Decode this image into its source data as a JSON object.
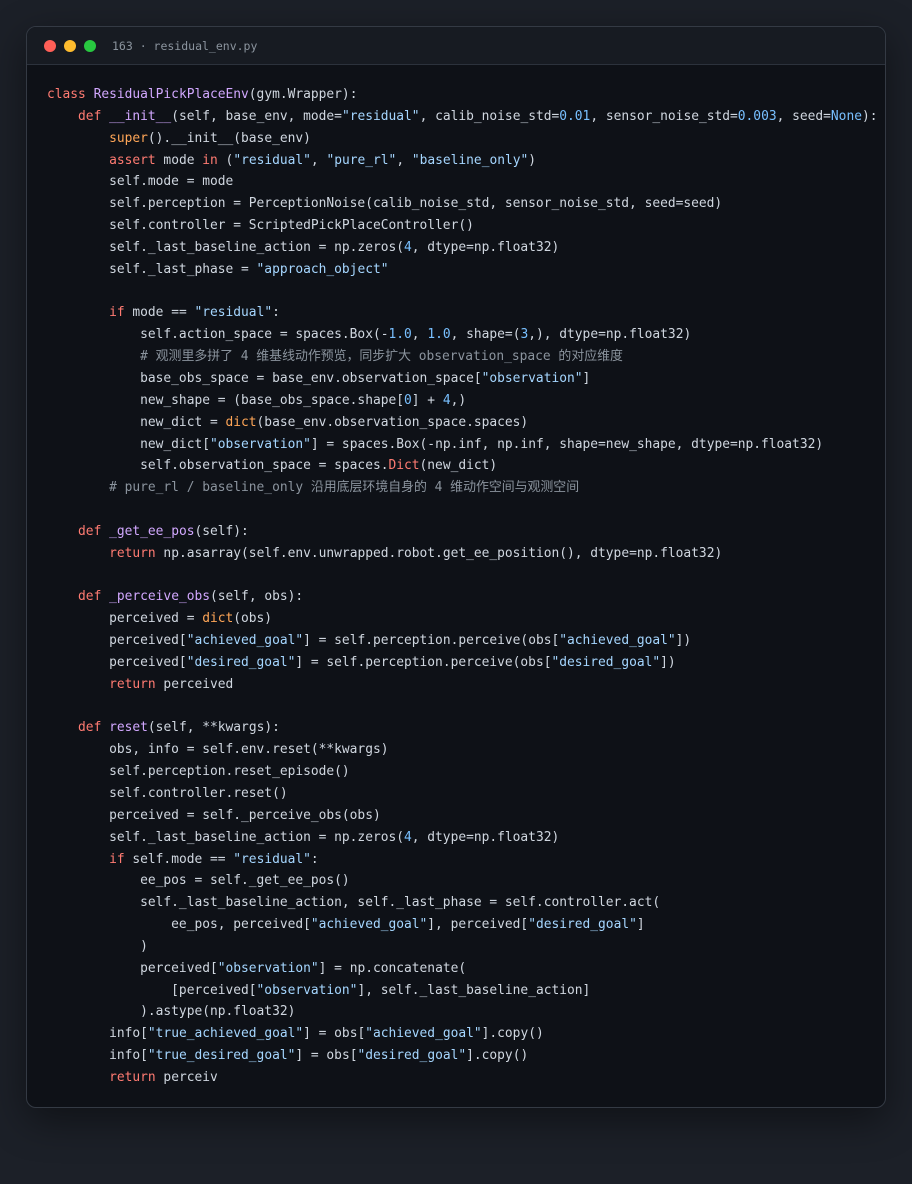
{
  "window": {
    "title": "163 · residual_env.py"
  },
  "colors": {
    "keyword": "#ff7b72",
    "builtin": "#ffa657",
    "function": "#d2a8ff",
    "string": "#a5d6ff",
    "number": "#79c0ff",
    "comment": "#8b949e",
    "text": "#d0d7e0",
    "background": "#0e1117"
  },
  "code": {
    "language": "python",
    "lines": [
      [
        [
          "kw",
          "class"
        ],
        [
          "t",
          " "
        ],
        [
          "fn",
          "ResidualPickPlaceEnv"
        ],
        [
          "t",
          "(gym.Wrapper):"
        ]
      ],
      [
        [
          "t",
          "    "
        ],
        [
          "kw",
          "def"
        ],
        [
          "t",
          " "
        ],
        [
          "fn",
          "__init__"
        ],
        [
          "t",
          "(self, base_env, mode="
        ],
        [
          "str",
          "\"residual\""
        ],
        [
          "t",
          ", calib_noise_std="
        ],
        [
          "num",
          "0.01"
        ],
        [
          "t",
          ", sensor_noise_std="
        ],
        [
          "num",
          "0.003"
        ],
        [
          "t",
          ", seed="
        ],
        [
          "num",
          "None"
        ],
        [
          "t",
          "):"
        ]
      ],
      [
        [
          "t",
          "        "
        ],
        [
          "bi",
          "super"
        ],
        [
          "t",
          "().__init__(base_env)"
        ]
      ],
      [
        [
          "t",
          "        "
        ],
        [
          "kw",
          "assert"
        ],
        [
          "t",
          " mode "
        ],
        [
          "kw",
          "in"
        ],
        [
          "t",
          " ("
        ],
        [
          "str",
          "\"residual\""
        ],
        [
          "t",
          ", "
        ],
        [
          "str",
          "\"pure_rl\""
        ],
        [
          "t",
          ", "
        ],
        [
          "str",
          "\"baseline_only\""
        ],
        [
          "t",
          ")"
        ]
      ],
      [
        [
          "t",
          "        self.mode = mode"
        ]
      ],
      [
        [
          "t",
          "        self.perception = PerceptionNoise(calib_noise_std, sensor_noise_std, seed=seed)"
        ]
      ],
      [
        [
          "t",
          "        self.controller = ScriptedPickPlaceController()"
        ]
      ],
      [
        [
          "t",
          "        self._last_baseline_action = np.zeros("
        ],
        [
          "num",
          "4"
        ],
        [
          "t",
          ", dtype=np.float32)"
        ]
      ],
      [
        [
          "t",
          "        self._last_phase = "
        ],
        [
          "str",
          "\"approach_object\""
        ]
      ],
      [],
      [
        [
          "t",
          "        "
        ],
        [
          "kw",
          "if"
        ],
        [
          "t",
          " mode == "
        ],
        [
          "str",
          "\"residual\""
        ],
        [
          "t",
          ":"
        ]
      ],
      [
        [
          "t",
          "            self.action_space = spaces.Box(-"
        ],
        [
          "num",
          "1.0"
        ],
        [
          "t",
          ", "
        ],
        [
          "num",
          "1.0"
        ],
        [
          "t",
          ", shape=("
        ],
        [
          "num",
          "3"
        ],
        [
          "t",
          ",), dtype=np.float32)"
        ]
      ],
      [
        [
          "t",
          "            "
        ],
        [
          "cm",
          "# 观测里多拼了 4 维基线动作预览，同步扩大 observation_space 的对应维度"
        ]
      ],
      [
        [
          "t",
          "            base_obs_space = base_env.observation_space["
        ],
        [
          "str",
          "\"observation\""
        ],
        [
          "t",
          "]"
        ]
      ],
      [
        [
          "t",
          "            new_shape = (base_obs_space.shape["
        ],
        [
          "num",
          "0"
        ],
        [
          "t",
          "] + "
        ],
        [
          "num",
          "4"
        ],
        [
          "t",
          ",)"
        ]
      ],
      [
        [
          "t",
          "            new_dict = "
        ],
        [
          "bi",
          "dict"
        ],
        [
          "t",
          "(base_env.observation_space.spaces)"
        ]
      ],
      [
        [
          "t",
          "            new_dict["
        ],
        [
          "str",
          "\"observation\""
        ],
        [
          "t",
          "] = spaces.Box(-np.inf, np.inf, shape=new_shape, dtype=np.float32)"
        ]
      ],
      [
        [
          "t",
          "            self.observation_space = spaces."
        ],
        [
          "kw",
          "Dict"
        ],
        [
          "t",
          "(new_dict)"
        ]
      ],
      [
        [
          "t",
          "        "
        ],
        [
          "cm",
          "# pure_rl / baseline_only 沿用底层环境自身的 4 维动作空间与观测空间"
        ]
      ],
      [],
      [
        [
          "t",
          "    "
        ],
        [
          "kw",
          "def"
        ],
        [
          "t",
          " "
        ],
        [
          "fn",
          "_get_ee_pos"
        ],
        [
          "t",
          "(self):"
        ]
      ],
      [
        [
          "t",
          "        "
        ],
        [
          "kw",
          "return"
        ],
        [
          "t",
          " np.asarray(self.env.unwrapped.robot.get_ee_position(), dtype=np.float32)"
        ]
      ],
      [],
      [
        [
          "t",
          "    "
        ],
        [
          "kw",
          "def"
        ],
        [
          "t",
          " "
        ],
        [
          "fn",
          "_perceive_obs"
        ],
        [
          "t",
          "(self, obs):"
        ]
      ],
      [
        [
          "t",
          "        perceived = "
        ],
        [
          "bi",
          "dict"
        ],
        [
          "t",
          "(obs)"
        ]
      ],
      [
        [
          "t",
          "        perceived["
        ],
        [
          "str",
          "\"achieved_goal\""
        ],
        [
          "t",
          "] = self.perception.perceive(obs["
        ],
        [
          "str",
          "\"achieved_goal\""
        ],
        [
          "t",
          "])"
        ]
      ],
      [
        [
          "t",
          "        perceived["
        ],
        [
          "str",
          "\"desired_goal\""
        ],
        [
          "t",
          "] = self.perception.perceive(obs["
        ],
        [
          "str",
          "\"desired_goal\""
        ],
        [
          "t",
          "])"
        ]
      ],
      [
        [
          "t",
          "        "
        ],
        [
          "kw",
          "return"
        ],
        [
          "t",
          " perceived"
        ]
      ],
      [],
      [
        [
          "t",
          "    "
        ],
        [
          "kw",
          "def"
        ],
        [
          "t",
          " "
        ],
        [
          "fn",
          "reset"
        ],
        [
          "t",
          "(self, **kwargs):"
        ]
      ],
      [
        [
          "t",
          "        obs, info = self.env.reset(**kwargs)"
        ]
      ],
      [
        [
          "t",
          "        self.perception.reset_episode()"
        ]
      ],
      [
        [
          "t",
          "        self.controller.reset()"
        ]
      ],
      [
        [
          "t",
          "        perceived = self._perceive_obs(obs)"
        ]
      ],
      [
        [
          "t",
          "        self._last_baseline_action = np.zeros("
        ],
        [
          "num",
          "4"
        ],
        [
          "t",
          ", dtype=np.float32)"
        ]
      ],
      [
        [
          "t",
          "        "
        ],
        [
          "kw",
          "if"
        ],
        [
          "t",
          " self.mode == "
        ],
        [
          "str",
          "\"residual\""
        ],
        [
          "t",
          ":"
        ]
      ],
      [
        [
          "t",
          "            ee_pos = self._get_ee_pos()"
        ]
      ],
      [
        [
          "t",
          "            self._last_baseline_action, self._last_phase = self.controller.act("
        ]
      ],
      [
        [
          "t",
          "                ee_pos, perceived["
        ],
        [
          "str",
          "\"achieved_goal\""
        ],
        [
          "t",
          "], perceived["
        ],
        [
          "str",
          "\"desired_goal\""
        ],
        [
          "t",
          "]"
        ]
      ],
      [
        [
          "t",
          "            )"
        ]
      ],
      [
        [
          "t",
          "            perceived["
        ],
        [
          "str",
          "\"observation\""
        ],
        [
          "t",
          "] = np.concatenate("
        ]
      ],
      [
        [
          "t",
          "                [perceived["
        ],
        [
          "str",
          "\"observation\""
        ],
        [
          "t",
          "], self._last_baseline_action]"
        ]
      ],
      [
        [
          "t",
          "            ).astype(np.float32)"
        ]
      ],
      [
        [
          "t",
          "        info["
        ],
        [
          "str",
          "\"true_achieved_goal\""
        ],
        [
          "t",
          "] = obs["
        ],
        [
          "str",
          "\"achieved_goal\""
        ],
        [
          "t",
          "].copy()"
        ]
      ],
      [
        [
          "t",
          "        info["
        ],
        [
          "str",
          "\"true_desired_goal\""
        ],
        [
          "t",
          "] = obs["
        ],
        [
          "str",
          "\"desired_goal\""
        ],
        [
          "t",
          "].copy()"
        ]
      ],
      [
        [
          "t",
          "        "
        ],
        [
          "kw",
          "return"
        ],
        [
          "t",
          " perceiv"
        ]
      ]
    ]
  }
}
